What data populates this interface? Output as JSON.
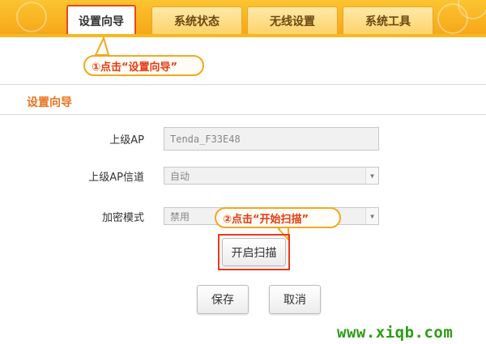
{
  "tabs": [
    {
      "label": "设置向导",
      "active": true
    },
    {
      "label": "系统状态",
      "active": false
    },
    {
      "label": "无线设置",
      "active": false
    },
    {
      "label": "系统工具",
      "active": false
    }
  ],
  "annotations": {
    "step1": "①点击“设置向导”",
    "step2": "②点击“开始扫描”"
  },
  "section_title": "设置向导",
  "form": {
    "upstream_ap_label": "上级AP",
    "upstream_ap_value": "Tenda_F33E48",
    "upstream_channel_label": "上级AP信道",
    "upstream_channel_value": "自动",
    "encryption_label": "加密模式",
    "encryption_value": "禁用",
    "scan_button": "开启扫描"
  },
  "buttons": {
    "save": "保存",
    "cancel": "取消"
  },
  "watermark": "www.xiqb.com",
  "colors": {
    "header": "#f6a417",
    "highlight": "#e8391b",
    "section_title": "#e8731b",
    "watermark": "#2c9d16"
  }
}
